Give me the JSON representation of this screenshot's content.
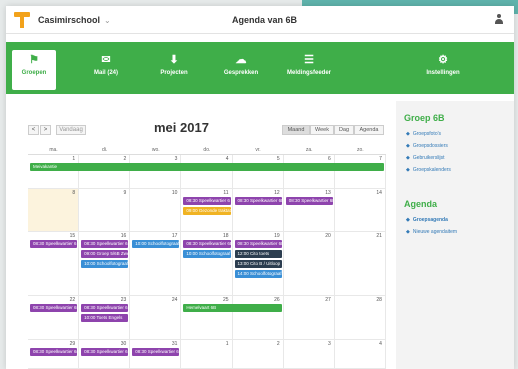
{
  "header": {
    "school": "Casimirschool",
    "title": "Agenda van 6B"
  },
  "nav": [
    {
      "label": "Groepen",
      "icon": "flag-icon",
      "glyph": "⚑",
      "active": true
    },
    {
      "label": "Mail (24)",
      "icon": "envelope-icon",
      "glyph": "✉"
    },
    {
      "label": "Projecten",
      "icon": "pin-icon",
      "glyph": "⬇"
    },
    {
      "label": "Gesprekken",
      "icon": "chat-icon",
      "glyph": "☁"
    },
    {
      "label": "Meldingsfeeder",
      "icon": "list-icon",
      "glyph": "☰"
    },
    {
      "label": "Instellingen",
      "icon": "gear-icon",
      "glyph": "⚙"
    }
  ],
  "calendar": {
    "prev": "<",
    "next": ">",
    "today": "Vandaag",
    "month": "mei 2017",
    "views": [
      "Maand",
      "Week",
      "Dag",
      "Agenda"
    ],
    "weekdays": [
      "ma.",
      "di.",
      "wo.",
      "do.",
      "vr.",
      "za.",
      "zo."
    ],
    "weeks": [
      [
        "1",
        "2",
        "3",
        "4",
        "5",
        "6",
        "7"
      ],
      [
        "8",
        "9",
        "10",
        "11",
        "12",
        "13",
        "14"
      ],
      [
        "15",
        "16",
        "17",
        "18",
        "19",
        "20",
        "21"
      ],
      [
        "22",
        "23",
        "24",
        "25",
        "26",
        "27",
        "28"
      ],
      [
        "29",
        "30",
        "31",
        "1",
        "2",
        "3",
        "4"
      ]
    ],
    "events": [
      {
        "week": 0,
        "col": 0,
        "span": 7,
        "row": 0,
        "text": "Meivakantie",
        "color": "#3fae49"
      },
      {
        "week": 1,
        "col": 3,
        "span": 1,
        "row": 0,
        "text": "08:30 Speelkwartier 6",
        "color": "#8e44ad"
      },
      {
        "week": 1,
        "col": 3,
        "span": 1,
        "row": 1,
        "text": "09:00 Gezonde traktatie",
        "color": "#f0b323"
      },
      {
        "week": 1,
        "col": 4,
        "span": 1,
        "row": 0,
        "text": "08:30 Speelkwartier 6B",
        "color": "#8e44ad"
      },
      {
        "week": 1,
        "col": 5,
        "span": 1,
        "row": 0,
        "text": "08:30 Speelkwartier 6B",
        "color": "#8e44ad"
      },
      {
        "week": 2,
        "col": 0,
        "span": 1,
        "row": 0,
        "text": "08:30 Speelkwartier 6",
        "color": "#8e44ad"
      },
      {
        "week": 2,
        "col": 1,
        "span": 1,
        "row": 0,
        "text": "08:30 Speelkwartier 6",
        "color": "#8e44ad"
      },
      {
        "week": 2,
        "col": 1,
        "span": 1,
        "row": 1,
        "text": "09:00 Groep 5/6B Zwemmen",
        "color": "#8e44ad"
      },
      {
        "week": 2,
        "col": 1,
        "span": 1,
        "row": 2,
        "text": "10:00 Schoolfotograaf",
        "color": "#3a8fd6"
      },
      {
        "week": 2,
        "col": 2,
        "span": 1,
        "row": 0,
        "text": "10:00 Schoolfotograaf",
        "color": "#3a8fd6"
      },
      {
        "week": 2,
        "col": 3,
        "span": 1,
        "row": 0,
        "text": "08:30 Speelkwartier 6B",
        "color": "#8e44ad"
      },
      {
        "week": 2,
        "col": 3,
        "span": 1,
        "row": 1,
        "text": "10:00 Schoolfotograaf",
        "color": "#3a8fd6"
      },
      {
        "week": 2,
        "col": 4,
        "span": 1,
        "row": 0,
        "text": "08:30 Speelkwartier 6B",
        "color": "#8e44ad"
      },
      {
        "week": 2,
        "col": 4,
        "span": 1,
        "row": 1,
        "text": "12:00 Cito toets",
        "color": "#2c3e50"
      },
      {
        "week": 2,
        "col": 4,
        "span": 1,
        "row": 2,
        "text": "13:00 Cito B / Uitloop",
        "color": "#2c3e50"
      },
      {
        "week": 2,
        "col": 4,
        "span": 1,
        "row": 3,
        "text": "14:00 Schoolfotograaf",
        "color": "#3a8fd6"
      },
      {
        "week": 3,
        "col": 0,
        "span": 1,
        "row": 0,
        "text": "08:30 Speelkwartier 6B",
        "color": "#8e44ad"
      },
      {
        "week": 3,
        "col": 1,
        "span": 1,
        "row": 0,
        "text": "08:30 Speelkwartier 6",
        "color": "#8e44ad"
      },
      {
        "week": 3,
        "col": 1,
        "span": 1,
        "row": 1,
        "text": "10:00 Toets Engels",
        "color": "#8e44ad"
      },
      {
        "week": 3,
        "col": 3,
        "span": 2,
        "row": 0,
        "text": "Hemelvaart 6B",
        "color": "#3fae49"
      },
      {
        "week": 4,
        "col": 0,
        "span": 1,
        "row": 0,
        "text": "08:30 Speelkwartier 6m",
        "color": "#8e44ad"
      },
      {
        "week": 4,
        "col": 1,
        "span": 1,
        "row": 0,
        "text": "08:30 Speelkwartier 6 Th",
        "color": "#8e44ad"
      },
      {
        "week": 4,
        "col": 2,
        "span": 1,
        "row": 0,
        "text": "08:30 Speelkwartier 6m",
        "color": "#8e44ad"
      }
    ]
  },
  "sidebar": {
    "group_title": "Groep 6B",
    "group_items": [
      "Groepsfoto's",
      "Groepsdossiers",
      "Gebruikerslijst",
      "Groepskalenders"
    ],
    "agenda_title": "Agenda",
    "agenda_items": [
      "Groepsagenda",
      "Nieuwe agendaitem"
    ]
  }
}
